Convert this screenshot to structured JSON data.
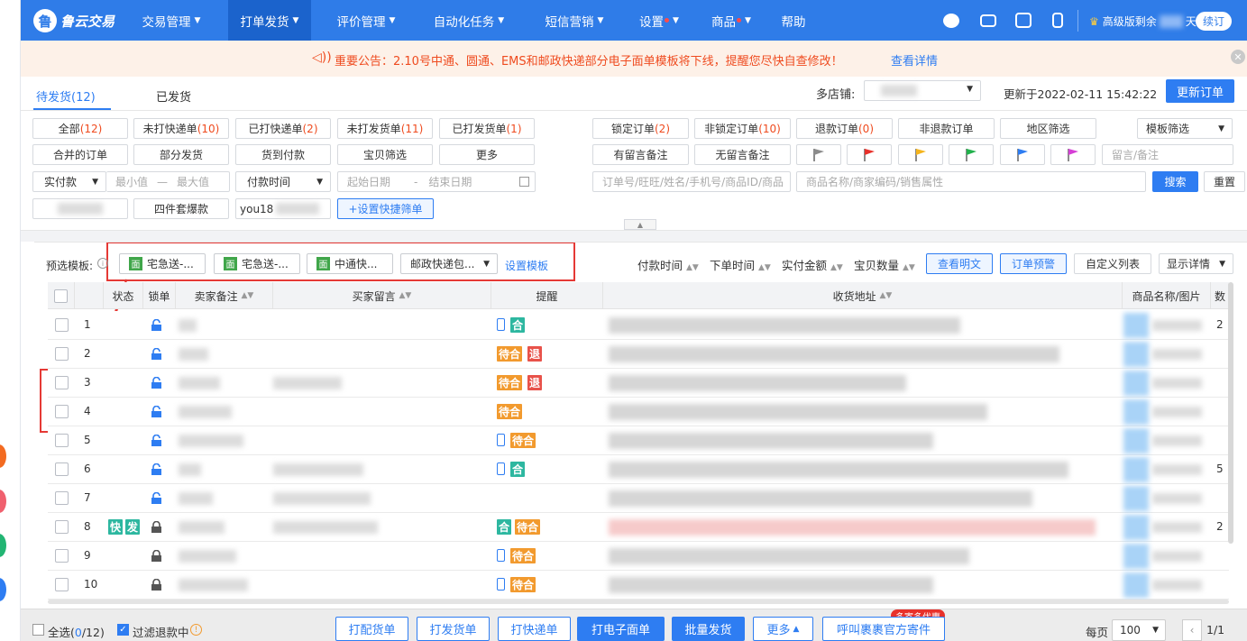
{
  "app": {
    "name": "鲁云交易"
  },
  "nav": [
    {
      "label": "交易管理",
      "chevron": true
    },
    {
      "label": "打单发货",
      "chevron": true,
      "active": true
    },
    {
      "label": "评价管理",
      "chevron": true
    },
    {
      "label": "自动化任务",
      "chevron": true
    },
    {
      "label": "短信营销",
      "chevron": true
    },
    {
      "label": "设置",
      "chevron": true,
      "dot": true
    },
    {
      "label": "商品",
      "chevron": true,
      "dot": true
    },
    {
      "label": "帮助",
      "chevron": false
    }
  ],
  "account": {
    "version_text": "高级版剩余",
    "days_suffix": "天",
    "renew_label": "续订"
  },
  "notice": {
    "text": "重要公告：2.10号中通、圆通、EMS和邮政快递部分电子面单模板将下线，提醒您尽快自查修改！",
    "link": "查看详情"
  },
  "tabs": {
    "pending": "待发货(12)",
    "shipped": "已发货"
  },
  "header_right": {
    "multi_store_label": "多店铺:",
    "updated_at": "更新于2022-02-11 15:42:22",
    "refresh_label": "更新订单"
  },
  "filters": {
    "row1": [
      {
        "label": "全部",
        "count": "(12)"
      },
      {
        "label": "未打快递单",
        "count": "(10)"
      },
      {
        "label": "已打快递单",
        "count": "(2)"
      },
      {
        "label": "未打发货单",
        "count": "(11)"
      },
      {
        "label": "已打发货单",
        "count": "(1)"
      }
    ],
    "row2": [
      "合并的订单",
      "部分发货",
      "货到付款",
      "宝贝筛选",
      "更多"
    ],
    "right_row1": [
      {
        "label": "锁定订单",
        "count": "(2)"
      },
      {
        "label": "非锁定订单",
        "count": "(10)"
      },
      {
        "label": "退款订单",
        "count": "(0)"
      },
      {
        "label": "非退款订单",
        "count": ""
      },
      {
        "label": "地区筛选",
        "count": ""
      }
    ],
    "template_filter": "模板筛选",
    "right_row2": [
      "有留言备注",
      "无留言备注"
    ],
    "flag_colors": [
      "#8c8c8c",
      "#e8312b",
      "#f5b51e",
      "#22b14c",
      "#2e7df2",
      "#d63fd6"
    ],
    "remark_placeholder": "留言/备注",
    "amount_select": "实付款",
    "min_placeholder": "最小值",
    "dash": "—",
    "max_placeholder": "最大值",
    "time_select": "付款时间",
    "start_placeholder": "起始日期",
    "end_placeholder": "结束日期",
    "order_search_placeholder": "订单号/旺旺/姓名/手机号/商品ID/商品",
    "goods_search_placeholder": "商品名称/商家编码/销售属性",
    "search_label": "搜索",
    "reset_label": "重置",
    "quick_four": "四件套爆款",
    "quick_you": "you18",
    "quick_add": "+设置快捷筛单"
  },
  "templates": {
    "label": "预选模板:",
    "items": [
      "宅急送-...",
      "宅急送-...",
      "中通快..."
    ],
    "select": "邮政快递包...",
    "setup": "设置模板",
    "mian": "面"
  },
  "sorts": [
    "付款时间",
    "下单时间",
    "实付金额",
    "宝贝数量"
  ],
  "actions": {
    "view_plain": "查看明文",
    "warn": "订单预警",
    "custom_list": "自定义列表",
    "detail": "显示详情"
  },
  "table": {
    "headers": {
      "status": "状态",
      "lock": "锁单",
      "seller_note": "卖家备注",
      "buyer_msg": "买家留言",
      "remind": "提醒",
      "address": "收货地址",
      "goods": "商品名称/图片",
      "qty": "数"
    },
    "rows": [
      {
        "n": "1",
        "locked": false,
        "phone": true,
        "tags": [
          "合"
        ],
        "qty": "2"
      },
      {
        "n": "2",
        "locked": false,
        "phone": false,
        "tags": [
          "待合",
          "退"
        ],
        "qty": ""
      },
      {
        "n": "3",
        "locked": false,
        "phone": false,
        "tags": [
          "待合",
          "退"
        ],
        "qty": ""
      },
      {
        "n": "4",
        "locked": false,
        "phone": false,
        "tags": [
          "待合"
        ],
        "qty": ""
      },
      {
        "n": "5",
        "locked": false,
        "phone": true,
        "tags": [
          "待合"
        ],
        "qty": ""
      },
      {
        "n": "6",
        "locked": false,
        "phone": true,
        "tags": [
          "合"
        ],
        "qty": "5"
      },
      {
        "n": "7",
        "locked": false,
        "phone": false,
        "tags": [],
        "qty": ""
      },
      {
        "n": "8",
        "locked": true,
        "phone": false,
        "tags": [
          "合",
          "待合"
        ],
        "qty": "2",
        "status_tags": [
          "快",
          "发"
        ]
      },
      {
        "n": "9",
        "locked": true,
        "phone": true,
        "tags": [
          "待合"
        ],
        "qty": ""
      },
      {
        "n": "10",
        "locked": true,
        "phone": true,
        "tags": [
          "待合"
        ],
        "qty": ""
      }
    ]
  },
  "bottom": {
    "select_all": "全选(",
    "select_count": "0",
    "select_total": "/12)",
    "filter_refund": "过滤退款中",
    "buttons": [
      "打配货单",
      "打发货单",
      "打快递单",
      "打电子面单",
      "批量发货",
      "更多",
      "呼叫裹裹官方寄件"
    ],
    "promo": "多寄多优惠",
    "per_page": "每页",
    "per_page_value": "100",
    "page": "1/1"
  }
}
